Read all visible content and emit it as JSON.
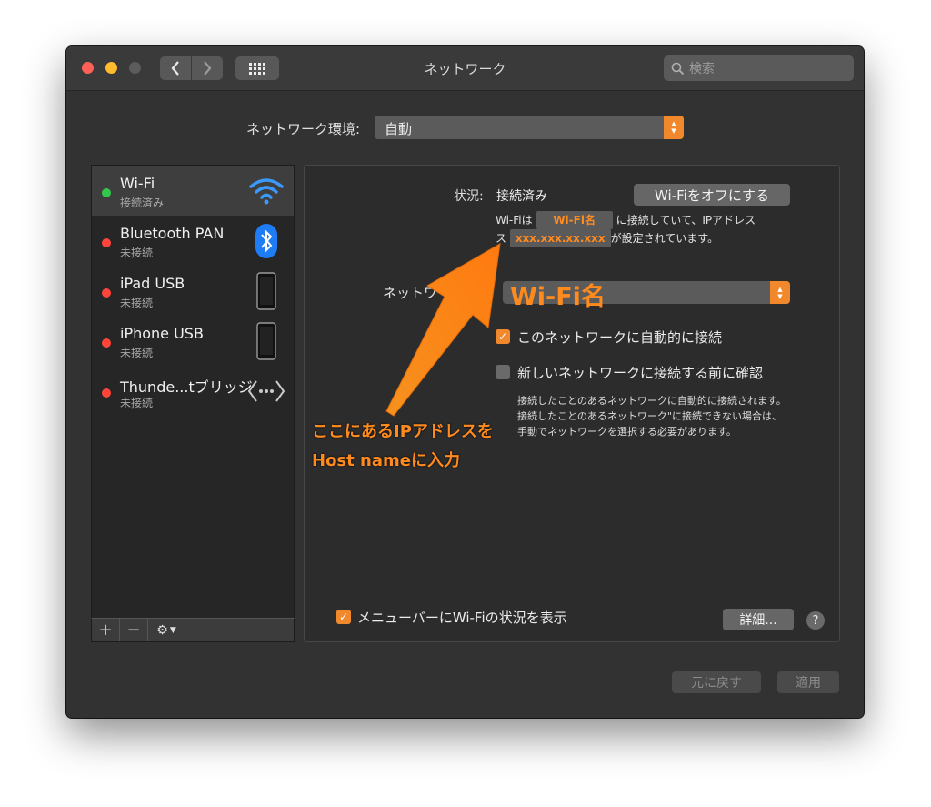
{
  "window": {
    "title": "ネットワーク",
    "search_placeholder": "検索"
  },
  "location": {
    "label": "ネットワーク環境:",
    "value": "自動"
  },
  "services": [
    {
      "name": "Wi-Fi",
      "status": "接続済み",
      "dot_color": "#34c84a",
      "icon": "wifi-icon"
    },
    {
      "name": "Bluetooth PAN",
      "status": "未接続",
      "dot_color": "#ff453a",
      "icon": "bluetooth-icon"
    },
    {
      "name": "iPad USB",
      "status": "未接続",
      "dot_color": "#ff453a",
      "icon": "ipad-icon"
    },
    {
      "name": "iPhone USB",
      "status": "未接続",
      "dot_color": "#ff453a",
      "icon": "iphone-icon"
    },
    {
      "name": "Thunde...tブリッジ",
      "status": "未接続",
      "dot_color": "#ff453a",
      "icon": "thunderbolt-bridge-icon"
    }
  ],
  "toolbar": {
    "add": "+",
    "remove": "−",
    "gear": "⚙︎"
  },
  "detail": {
    "status_label": "状況:",
    "status_value": "接続済み",
    "wifi_off_button": "Wi-Fiをオフにする",
    "desc_prefix": "Wi-Fiは",
    "desc_mid": "に接続していて、IPアドレス",
    "desc_suffix": "が設定されています。",
    "annot_wifi_name": "Wi-Fi名",
    "annot_ip": "xxx.xxx.xx.xxx",
    "network_name_label": "ネットワ",
    "network_name_value": "Wi-Fi名",
    "auto_join_label": "このネットワークに自動的に接続",
    "ask_join_label": "新しいネットワークに接続する前に確認",
    "note": "接続したことのあるネットワークに自動的に接続されます。接続したことのあるネットワーク\"に接続できない場合は、手動でネットワークを選択する必要があります。",
    "menubar_label": "メニューバーにWi-Fiの状況を表示",
    "advanced_button": "詳細...",
    "help_button": "?"
  },
  "footer": {
    "revert": "元に戻す",
    "apply": "適用"
  },
  "annotation": {
    "line1": "ここにあるIPアドレスを",
    "line2": "Host nameに入力"
  },
  "colors": {
    "accent": "#f1882c",
    "annotation": "#ff8a1e"
  }
}
